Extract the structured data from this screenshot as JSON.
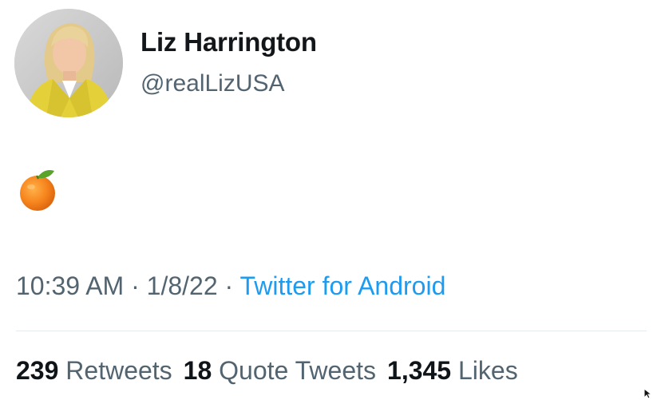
{
  "author": {
    "display_name": "Liz Harrington",
    "handle": "@realLizUSA"
  },
  "tweet": {
    "content_icon": "tangerine-emoji",
    "time": "10:39 AM",
    "separator": "·",
    "date": "1/8/22",
    "source": "Twitter for Android"
  },
  "stats": {
    "retweets_count": "239",
    "retweets_label": "Retweets",
    "quotes_count": "18",
    "quotes_label": "Quote Tweets",
    "likes_count": "1,345",
    "likes_label": "Likes"
  },
  "colors": {
    "text_primary": "#0f1419",
    "text_secondary": "#536471",
    "link": "#1d9bf0",
    "divider": "#e6ebee"
  }
}
